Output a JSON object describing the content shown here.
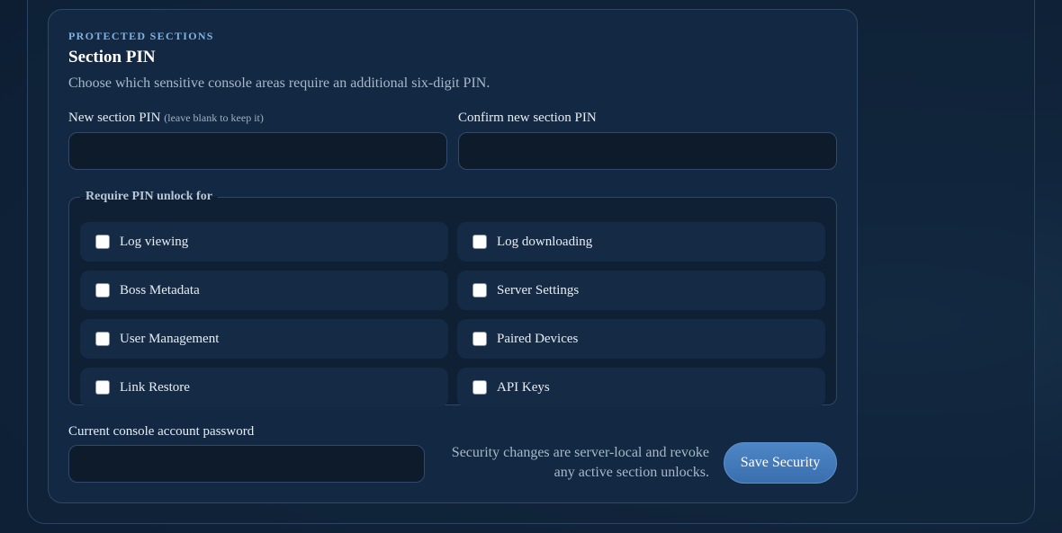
{
  "section": {
    "eyebrow": "PROTECTED SECTIONS",
    "title": "Section PIN",
    "description": "Choose which sensitive console areas require an additional six-digit PIN."
  },
  "pin": {
    "new_label": "New section PIN",
    "new_hint": "(leave blank to keep it)",
    "new_value": "",
    "confirm_label": "Confirm new section PIN",
    "confirm_value": ""
  },
  "require_group": {
    "legend": "Require PIN unlock for",
    "options": [
      {
        "label": "Log viewing",
        "checked": false
      },
      {
        "label": "Log downloading",
        "checked": false
      },
      {
        "label": "Boss Metadata",
        "checked": false
      },
      {
        "label": "Server Settings",
        "checked": false
      },
      {
        "label": "User Management",
        "checked": false
      },
      {
        "label": "Paired Devices",
        "checked": false
      },
      {
        "label": "Link Restore",
        "checked": false
      },
      {
        "label": "API Keys",
        "checked": false
      }
    ]
  },
  "password": {
    "label": "Current console account password",
    "value": ""
  },
  "footer": {
    "note": "Security changes are server-local and revoke any active section unlocks.",
    "save_label": "Save Security"
  }
}
